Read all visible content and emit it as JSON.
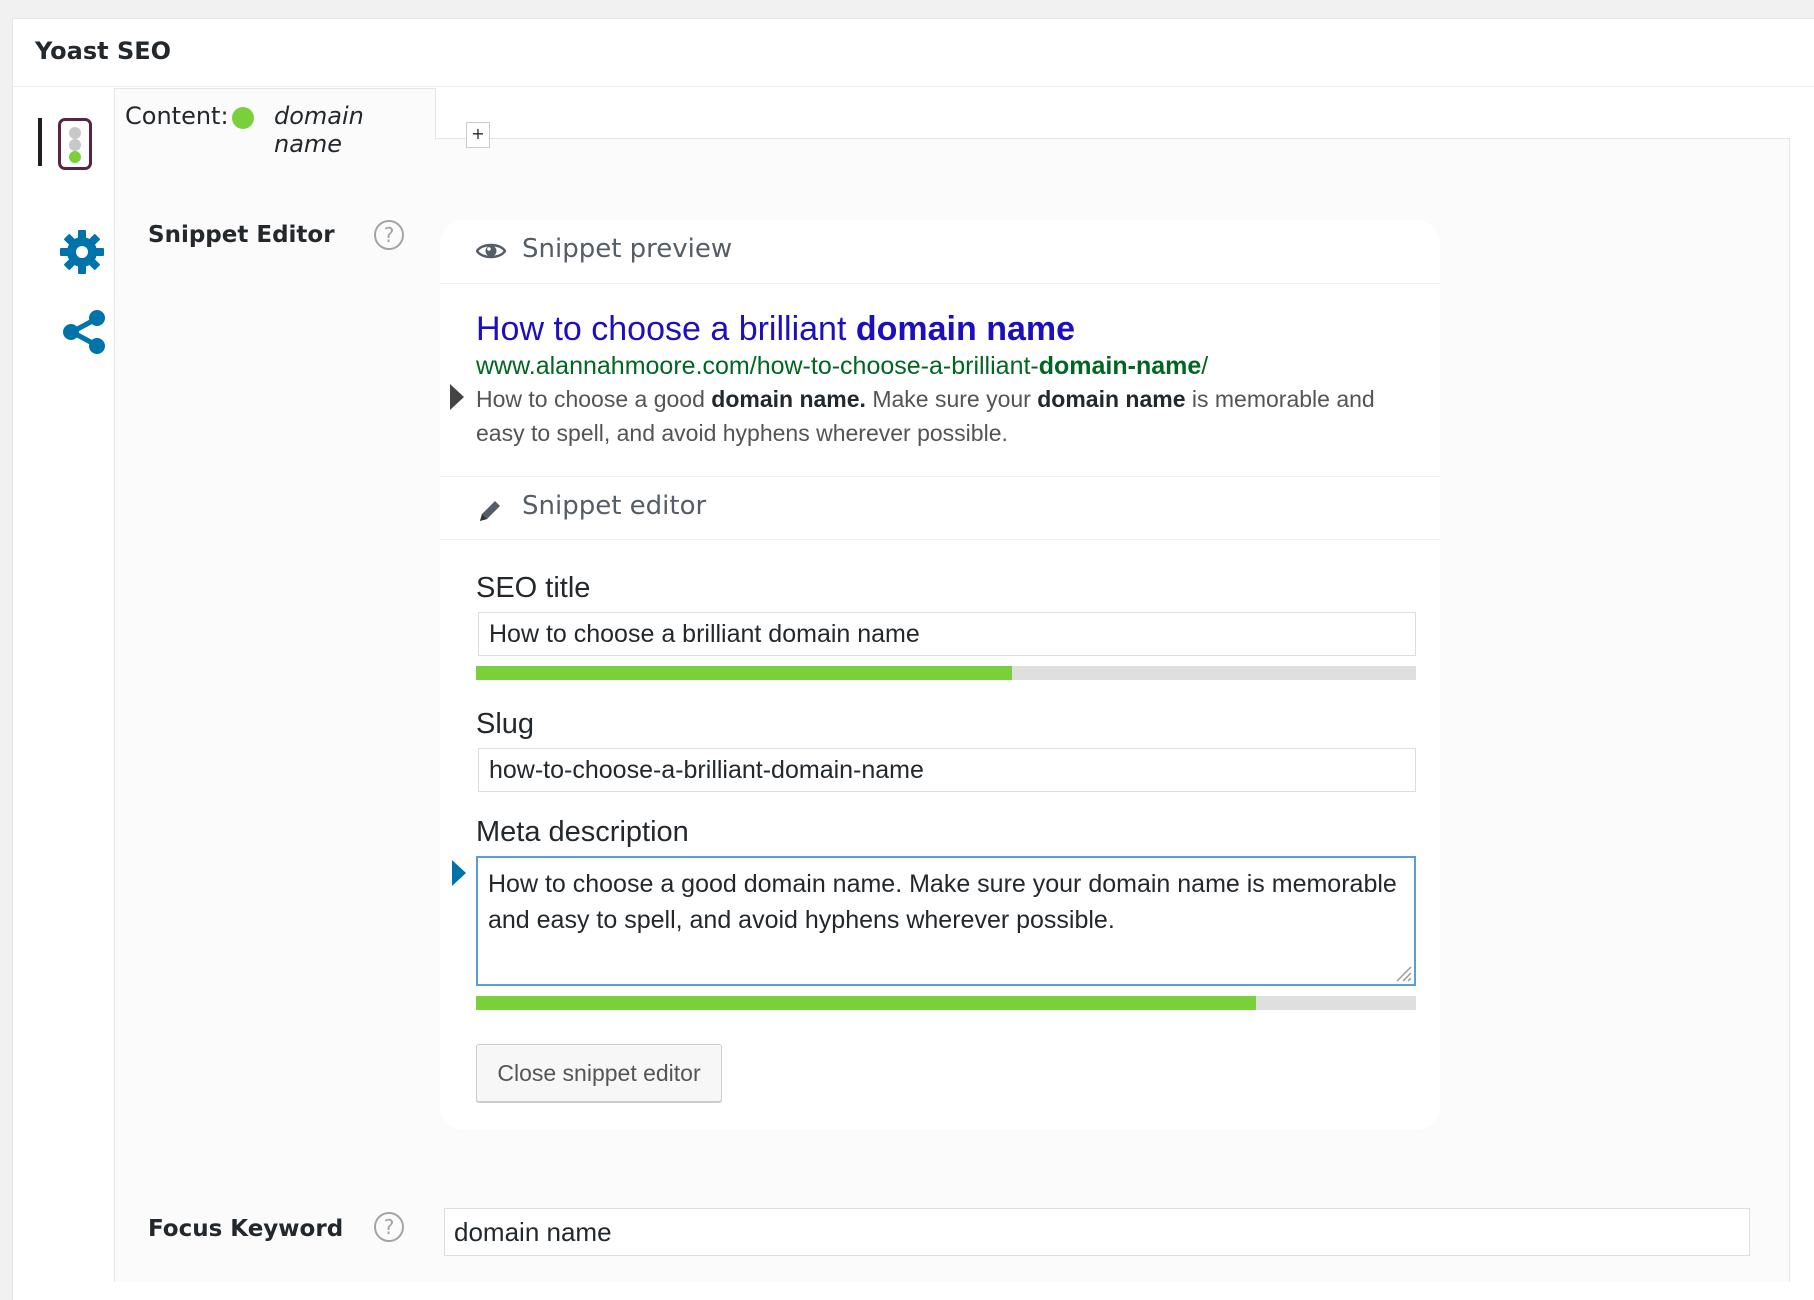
{
  "metabox": {
    "title": "Yoast SEO"
  },
  "tabs": {
    "content_label": "Content:",
    "content_keyword": "domain name",
    "add_label": "+",
    "status_color": "#7ad03a"
  },
  "side_icons": [
    "traffic-light-icon",
    "gear-icon",
    "share-icon"
  ],
  "snippet_editor": {
    "label": "Snippet Editor",
    "help": "?",
    "preview_heading": "Snippet preview",
    "editor_heading": "Snippet editor",
    "preview": {
      "title_plain": "How to choose a brilliant ",
      "title_bold": "domain name",
      "url_plain": "www.alannahmoore.com/how-to-choose-a-brilliant-",
      "url_bold": "domain-name",
      "url_end": "/",
      "desc_1": "How to choose a good ",
      "desc_2": "domain name.",
      "desc_3": " Make sure your ",
      "desc_4": "domain name",
      "desc_5": " is memorable and easy to spell, and avoid hyphens wherever possible."
    },
    "seo_title": {
      "label": "SEO title",
      "value": "How to choose a brilliant domain name",
      "progress": 0.57
    },
    "slug": {
      "label": "Slug",
      "value": "how-to-choose-a-brilliant-domain-name"
    },
    "meta_description": {
      "label": "Meta description",
      "value": "How to choose a good domain name. Make sure your domain name is memorable and easy to spell, and avoid hyphens wherever possible.",
      "progress": 0.83
    },
    "close_button": "Close snippet editor"
  },
  "focus_keyword": {
    "label": "Focus Keyword",
    "help": "?",
    "value": "domain name"
  },
  "colors": {
    "serp_title": "#1e0fbe",
    "serp_url": "#006621",
    "progress_good": "#7ad03a",
    "accent": "#0073aa"
  }
}
